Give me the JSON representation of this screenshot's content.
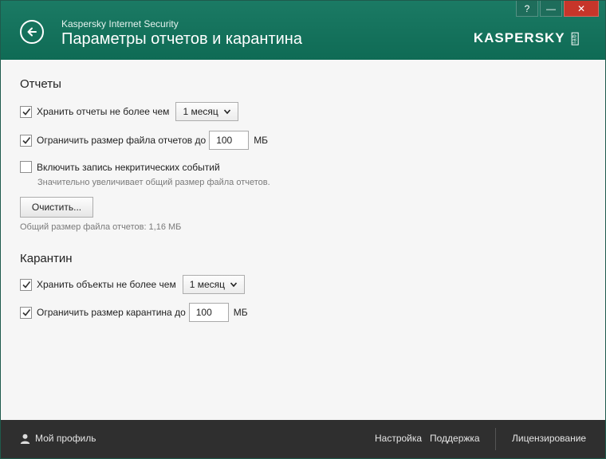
{
  "header": {
    "app_name": "Kaspersky Internet Security",
    "title": "Параметры отчетов и карантина",
    "brand": "KASPERSKY",
    "brand_suffix": "lab",
    "help_label": "?",
    "minimize_label": "—",
    "close_label": "✕"
  },
  "reports": {
    "title": "Отчеты",
    "keep_reports": {
      "checked": true,
      "label": "Хранить отчеты не более чем",
      "selected": "1 месяц"
    },
    "limit_size": {
      "checked": true,
      "label": "Ограничить размер файла отчетов до",
      "value": "100",
      "unit": "МБ"
    },
    "noncritical": {
      "checked": false,
      "label": "Включить запись некритических событий",
      "hint": "Значительно увеличивает общий размер файла отчетов."
    },
    "clear_button": "Очистить...",
    "total_size": "Общий размер файла отчетов: 1,16 МБ"
  },
  "quarantine": {
    "title": "Карантин",
    "keep_objects": {
      "checked": true,
      "label": "Хранить объекты не более чем",
      "selected": "1 месяц"
    },
    "limit_size": {
      "checked": true,
      "label": "Ограничить размер карантина до",
      "value": "100",
      "unit": "МБ"
    }
  },
  "footer": {
    "profile": "Мой профиль",
    "settings": "Настройка",
    "support": "Поддержка",
    "licensing": "Лицензирование"
  },
  "colors": {
    "header_bg": "#127360",
    "footer_bg": "#2f2f2f",
    "close_bg": "#c7352a"
  }
}
